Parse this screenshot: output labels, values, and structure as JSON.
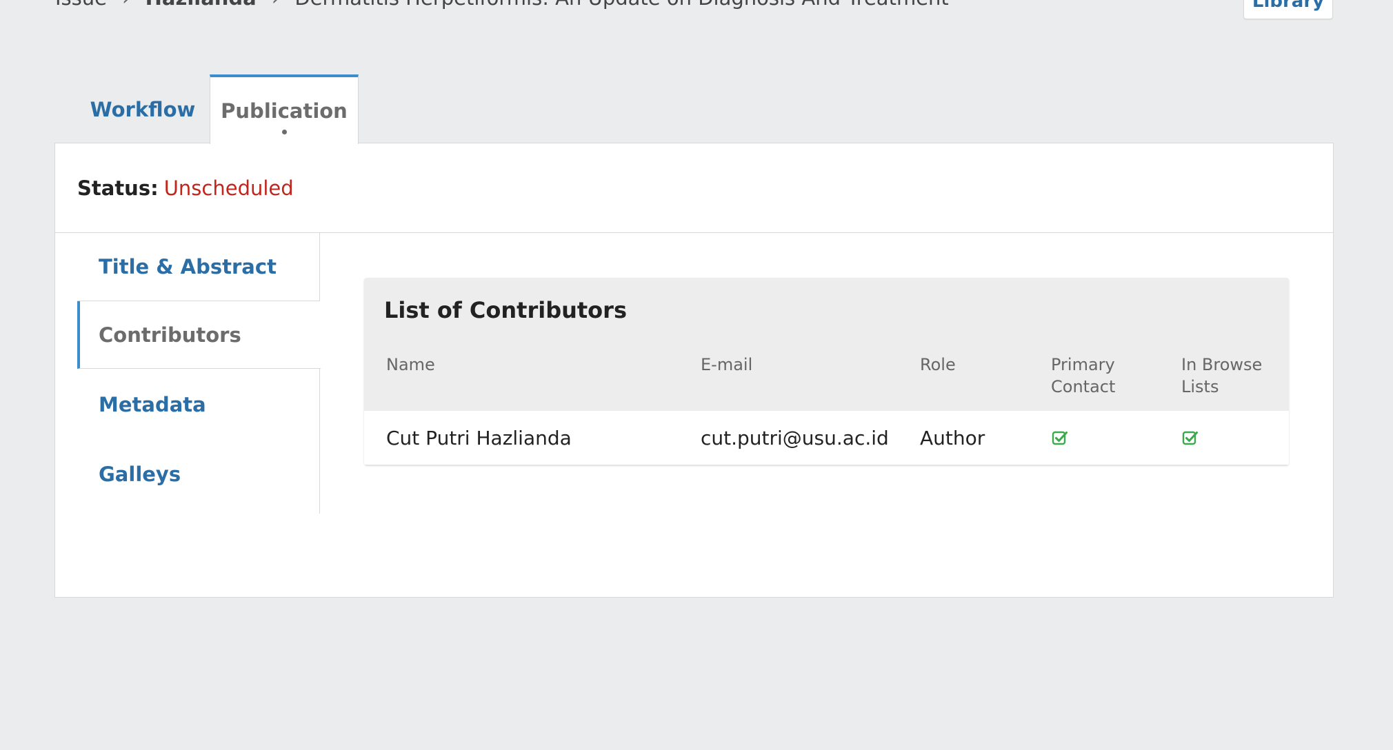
{
  "breadcrumb": {
    "item1": "Issue",
    "item2": "Hazlianda",
    "item3": "Dermatitis Herpetiformis: An Update on Diagnosis And Treatment",
    "sep": "›"
  },
  "header": {
    "library_label": "Library"
  },
  "tabs": [
    {
      "label": "Workflow"
    },
    {
      "label": "Publication"
    }
  ],
  "status": {
    "label": "Status:",
    "value": "Unscheduled",
    "value_color": "#c0261d"
  },
  "side_nav": {
    "items": [
      {
        "label": "Title & Abstract"
      },
      {
        "label": "Contributors"
      },
      {
        "label": "Metadata"
      },
      {
        "label": "Galleys"
      }
    ]
  },
  "contributors": {
    "title": "List of Contributors",
    "columns": {
      "name": "Name",
      "email": "E-mail",
      "role": "Role",
      "primary_contact_line1": "Primary",
      "primary_contact_line2": "Contact",
      "browse_line1": "In Browse",
      "browse_line2": "Lists"
    },
    "rows": [
      {
        "name": "Cut Putri Hazlianda",
        "email": "cut.putri@usu.ac.id",
        "role": "Author",
        "primary_contact_icon": "check-square-icon",
        "browse_icon": "check-square-icon"
      }
    ]
  },
  "colors": {
    "accent": "#3b8dcb",
    "link": "#2b6ea6",
    "check": "#3aa84b"
  }
}
